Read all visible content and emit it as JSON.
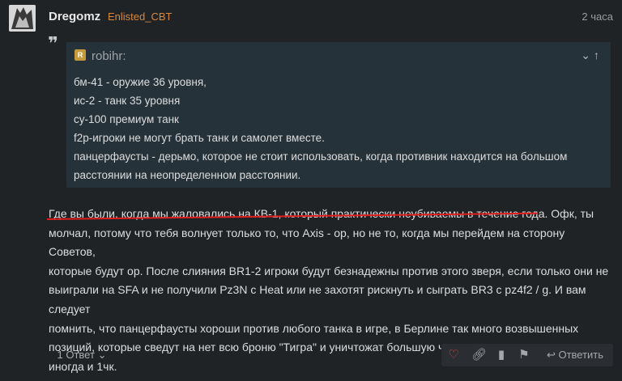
{
  "post": {
    "username": "Dregomz",
    "user_title": "Enlisted_CBT",
    "time": "2 часа"
  },
  "quote": {
    "author": "robihr:",
    "avatar_letter": "R",
    "lines": [
      "бм-41 - оружие 36 уровня,",
      "ис-2 - танк 35 уровня",
      "су-100 премиум танк",
      "f2p-игроки не могут брать танк и самолет вместе.",
      "панцерфаусты - дерьмо, которое не стоит использовать, когда противник находится на большом",
      "расстоянии на неопределенном расстоянии."
    ]
  },
  "body": {
    "lines": [
      "Где вы были, когда мы жаловались на КВ-1, который практически неубиваемы в течение года. Офк, ты",
      "молчал, потому что тебя волнует только то, что Axis - ор, но не то, когда мы перейдем на сторону Советов,",
      "которые будут ор. После слияния BR1-2 игроки будут безнадежны против этого зверя, если только они не",
      "выиграли на SFA и не получили Pz3N с Heat или не захотят рискнуть и сыграть BR3 с pz4f2 / g. И вам следует",
      "помнить, что панцерфаусты хороши против любого танка в игре, в Берлине так много возвышенных",
      "позиций, которые сведут на нет всю броню \"Тигра\" и уничтожат большую часть экипажа одним ударом, а",
      "иногда и 1чк."
    ]
  },
  "footer": {
    "replies_label": "1 Ответ",
    "reply_label": "Ответить"
  },
  "icons": {
    "like": "heart-icon",
    "link": "link-icon",
    "bookmark": "bookmark-icon",
    "flag": "flag-icon",
    "reply": "reply-icon"
  },
  "colors": {
    "background": "#1f2326",
    "quote_bg": "#26323a",
    "user_title": "#d7883d",
    "like": "#e04545",
    "underline": "#e01e1e"
  }
}
